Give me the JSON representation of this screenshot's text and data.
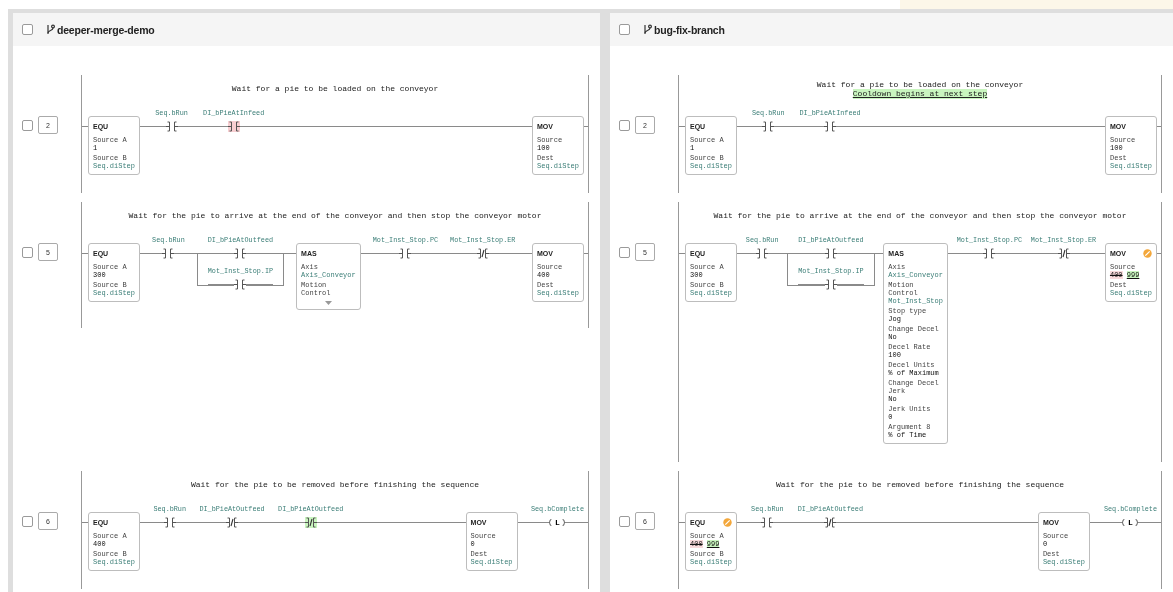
{
  "panels": [
    {
      "branch": "deeper-merge-demo",
      "checked": false,
      "rungs": [
        {
          "number": "2",
          "checked": false,
          "comment": [
            {
              "text": "Wait for a pie to be loaded on the conveyor",
              "added": false
            }
          ],
          "elements": [
            {
              "kind": "box",
              "title": "EQU",
              "changed": false,
              "params": [
                {
                  "label": "Source A",
                  "value": "1",
                  "kind": "literal"
                },
                {
                  "label": "Source B",
                  "value": "Seq.diStep",
                  "kind": "tag"
                }
              ]
            },
            {
              "kind": "contact",
              "tag": "Seq.bRun",
              "negated": false,
              "added": false,
              "removed": false
            },
            {
              "kind": "contact",
              "tag": "DI_bPieAtInfeed",
              "negated": false,
              "added": false,
              "removed": true
            },
            {
              "kind": "box",
              "title": "MOV",
              "changed": false,
              "params": [
                {
                  "label": "Source",
                  "value": "100",
                  "kind": "literal"
                },
                {
                  "label": "Dest",
                  "value": "Seq.diStep",
                  "kind": "tag"
                }
              ]
            }
          ]
        },
        {
          "number": "5",
          "checked": false,
          "comment": [
            {
              "text": "Wait for the pie to arrive at the end of the conveyor and then stop the conveyor motor",
              "added": false
            }
          ],
          "elements": [
            {
              "kind": "box",
              "title": "EQU",
              "changed": false,
              "params": [
                {
                  "label": "Source A",
                  "value": "300",
                  "kind": "literal"
                },
                {
                  "label": "Source B",
                  "value": "Seq.diStep",
                  "kind": "tag"
                }
              ]
            },
            {
              "kind": "contact",
              "tag": "Seq.bRun",
              "negated": false,
              "added": false,
              "removed": false
            },
            {
              "kind": "branch",
              "contacts": [
                {
                  "tag": "DI_bPieAtOutfeed",
                  "negated": false,
                  "added": false,
                  "removed": false
                },
                {
                  "tag": "Mot_Inst_Stop.IP",
                  "negated": false,
                  "added": false,
                  "removed": false
                }
              ]
            },
            {
              "kind": "box",
              "title": "MAS",
              "changed": false,
              "expanded": false,
              "params": [
                {
                  "label": "Axis",
                  "value": "Axis_Conveyor",
                  "kind": "tag"
                },
                {
                  "label": "Motion Control",
                  "kind": "label_only"
                }
              ]
            },
            {
              "kind": "contact",
              "tag": "Mot_Inst_Stop.PC",
              "negated": false,
              "added": false,
              "removed": false
            },
            {
              "kind": "contact",
              "tag": "Mot_Inst_Stop.ER",
              "negated": true,
              "added": false,
              "removed": false
            },
            {
              "kind": "box",
              "title": "MOV",
              "changed": false,
              "params": [
                {
                  "label": "Source",
                  "value": "400",
                  "kind": "literal"
                },
                {
                  "label": "Dest",
                  "value": "Seq.diStep",
                  "kind": "tag"
                }
              ]
            }
          ]
        },
        {
          "number": "6",
          "checked": false,
          "comment": [
            {
              "text": "Wait for the pie to be removed before finishing the sequence",
              "added": false
            }
          ],
          "elements": [
            {
              "kind": "box",
              "title": "EQU",
              "changed": false,
              "params": [
                {
                  "label": "Source A",
                  "value": "400",
                  "kind": "literal"
                },
                {
                  "label": "Source B",
                  "value": "Seq.diStep",
                  "kind": "tag"
                }
              ]
            },
            {
              "kind": "contact",
              "tag": "Seq.bRun",
              "negated": false,
              "added": false,
              "removed": false
            },
            {
              "kind": "contact",
              "tag": "DI_bPieAtOutfeed",
              "negated": true,
              "added": false,
              "removed": false
            },
            {
              "kind": "contact",
              "tag": "DI_bPieAtOutfeed",
              "negated": true,
              "added": true,
              "removed": false
            },
            {
              "kind": "box",
              "title": "MOV",
              "changed": false,
              "params": [
                {
                  "label": "Source",
                  "value": "0",
                  "kind": "literal"
                },
                {
                  "label": "Dest",
                  "value": "Seq.diStep",
                  "kind": "tag"
                }
              ]
            },
            {
              "kind": "coil",
              "tag": "Seq.bComplete",
              "symbol": "L"
            }
          ]
        }
      ]
    },
    {
      "branch": "bug-fix-branch",
      "checked": false,
      "rungs": [
        {
          "number": "2",
          "checked": false,
          "comment": [
            {
              "text": "Wait for a pie to be loaded on the conveyor",
              "added": false
            },
            {
              "text": "Cooldown begins at next step",
              "added": true
            }
          ],
          "elements": [
            {
              "kind": "box",
              "title": "EQU",
              "changed": false,
              "params": [
                {
                  "label": "Source A",
                  "value": "1",
                  "kind": "literal"
                },
                {
                  "label": "Source B",
                  "value": "Seq.diStep",
                  "kind": "tag"
                }
              ]
            },
            {
              "kind": "contact",
              "tag": "Seq.bRun",
              "negated": false,
              "added": false,
              "removed": false
            },
            {
              "kind": "contact",
              "tag": "DI_bPieAtInfeed",
              "negated": false,
              "added": false,
              "removed": false
            },
            {
              "kind": "box",
              "title": "MOV",
              "changed": false,
              "params": [
                {
                  "label": "Source",
                  "value": "100",
                  "kind": "literal"
                },
                {
                  "label": "Dest",
                  "value": "Seq.diStep",
                  "kind": "tag"
                }
              ]
            }
          ]
        },
        {
          "number": "5",
          "checked": false,
          "comment": [
            {
              "text": "Wait for the pie to arrive at the end of the conveyor and then stop the conveyor motor",
              "added": false
            }
          ],
          "elements": [
            {
              "kind": "box",
              "title": "EQU",
              "changed": false,
              "params": [
                {
                  "label": "Source A",
                  "value": "300",
                  "kind": "literal"
                },
                {
                  "label": "Source B",
                  "value": "Seq.diStep",
                  "kind": "tag"
                }
              ]
            },
            {
              "kind": "contact",
              "tag": "Seq.bRun",
              "negated": false,
              "added": false,
              "removed": false
            },
            {
              "kind": "branch",
              "contacts": [
                {
                  "tag": "DI_bPieAtOutfeed",
                  "negated": false,
                  "added": false,
                  "removed": false
                },
                {
                  "tag": "Mot_Inst_Stop.IP",
                  "negated": false,
                  "added": false,
                  "removed": false
                }
              ]
            },
            {
              "kind": "box",
              "title": "MAS",
              "changed": false,
              "expanded": true,
              "params": [
                {
                  "label": "Axis",
                  "value": "Axis_Conveyor",
                  "kind": "tag"
                },
                {
                  "label": "Motion Control",
                  "value": "Mot_Inst_Stop",
                  "kind": "tag"
                },
                {
                  "label": "Stop type",
                  "value": "Jog",
                  "kind": "literal"
                },
                {
                  "label": "Change Decel",
                  "value": "No",
                  "kind": "literal"
                },
                {
                  "label": "Decel Rate",
                  "value": "100",
                  "kind": "literal"
                },
                {
                  "label": "Decel Units",
                  "value": "% of Maximum",
                  "kind": "literal"
                },
                {
                  "label": "Change Decel Jerk",
                  "value": "No",
                  "kind": "literal"
                },
                {
                  "label": "Jerk Units",
                  "value": "0",
                  "kind": "literal"
                },
                {
                  "label": "Argument 8",
                  "value": "% of Time",
                  "kind": "literal"
                }
              ]
            },
            {
              "kind": "contact",
              "tag": "Mot_Inst_Stop.PC",
              "negated": false,
              "added": false,
              "removed": false
            },
            {
              "kind": "contact",
              "tag": "Mot_Inst_Stop.ER",
              "negated": true,
              "added": false,
              "removed": false
            },
            {
              "kind": "box",
              "title": "MOV",
              "changed": true,
              "params": [
                {
                  "label": "Source",
                  "old": "400",
                  "new": "999",
                  "kind": "changed"
                },
                {
                  "label": "Dest",
                  "value": "Seq.diStep",
                  "kind": "tag"
                }
              ]
            }
          ]
        },
        {
          "number": "6",
          "checked": false,
          "comment": [
            {
              "text": "Wait for the pie to be removed before finishing the sequence",
              "added": false
            }
          ],
          "elements": [
            {
              "kind": "box",
              "title": "EQU",
              "changed": true,
              "params": [
                {
                  "label": "Source A",
                  "old": "400",
                  "new": "999",
                  "kind": "changed"
                },
                {
                  "label": "Source B",
                  "value": "Seq.diStep",
                  "kind": "tag"
                }
              ]
            },
            {
              "kind": "contact",
              "tag": "Seq.bRun",
              "negated": false,
              "added": false,
              "removed": false
            },
            {
              "kind": "contact",
              "tag": "DI_bPieAtOutfeed",
              "negated": true,
              "added": false,
              "removed": false
            },
            {
              "kind": "box",
              "title": "MOV",
              "changed": false,
              "params": [
                {
                  "label": "Source",
                  "value": "0",
                  "kind": "literal"
                },
                {
                  "label": "Dest",
                  "value": "Seq.diStep",
                  "kind": "tag"
                }
              ]
            },
            {
              "kind": "coil",
              "tag": "Seq.bComplete",
              "symbol": "L"
            }
          ]
        }
      ]
    }
  ]
}
